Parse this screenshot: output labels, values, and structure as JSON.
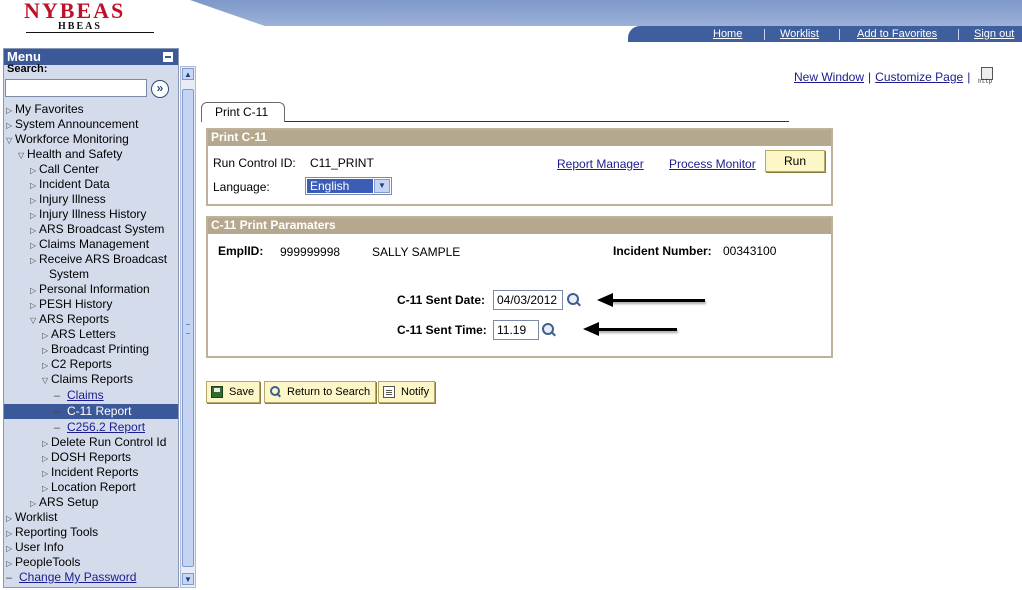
{
  "header": {
    "logo_title": "NYBEAS",
    "logo_subtitle": "HBEAS",
    "nav": [
      "Home",
      "Worklist",
      "Add to Favorites",
      "Sign out"
    ]
  },
  "menu": {
    "title": "Menu",
    "search_label": "Search:",
    "search_value": "",
    "search_go_icon": "go-arrow-icon",
    "items": [
      {
        "label": "My Favorites",
        "icon": "collapsed"
      },
      {
        "label": "System Announcement",
        "icon": "collapsed"
      },
      {
        "label": "Workforce Monitoring",
        "icon": "expanded"
      },
      {
        "label": "Health and Safety",
        "icon": "expanded"
      },
      {
        "label": "Call Center",
        "icon": "collapsed"
      },
      {
        "label": "Incident Data",
        "icon": "collapsed"
      },
      {
        "label": "Injury Illness",
        "icon": "collapsed"
      },
      {
        "label": "Injury Illness History",
        "icon": "collapsed"
      },
      {
        "label": "ARS Broadcast System",
        "icon": "collapsed"
      },
      {
        "label": "Claims Management",
        "icon": "collapsed"
      },
      {
        "label": "Receive ARS Broadcast",
        "icon": "collapsed"
      },
      {
        "label": "System",
        "icon": "none"
      },
      {
        "label": "Personal Information",
        "icon": "collapsed"
      },
      {
        "label": "PESH History",
        "icon": "collapsed"
      },
      {
        "label": "ARS Reports",
        "icon": "expanded"
      },
      {
        "label": "ARS Letters",
        "icon": "collapsed"
      },
      {
        "label": "Broadcast Printing",
        "icon": "collapsed"
      },
      {
        "label": "C2 Reports",
        "icon": "collapsed"
      },
      {
        "label": "Claims Reports",
        "icon": "expanded"
      },
      {
        "label": "Claims",
        "icon": "dash"
      },
      {
        "label": "C-11 Report",
        "icon": "dash",
        "selected": true
      },
      {
        "label": "C256.2 Report",
        "icon": "dash"
      },
      {
        "label": "Delete Run Control Id",
        "icon": "collapsed"
      },
      {
        "label": "DOSH Reports",
        "icon": "collapsed"
      },
      {
        "label": "Incident Reports",
        "icon": "collapsed"
      },
      {
        "label": "Location Report",
        "icon": "collapsed"
      },
      {
        "label": "ARS Setup",
        "icon": "collapsed"
      },
      {
        "label": "Worklist",
        "icon": "collapsed"
      },
      {
        "label": "Reporting Tools",
        "icon": "collapsed"
      },
      {
        "label": "User Info",
        "icon": "collapsed"
      },
      {
        "label": "PeopleTools",
        "icon": "collapsed"
      },
      {
        "label": "Change My Password",
        "icon": "dash"
      }
    ]
  },
  "page_links": {
    "new_window": "New Window",
    "customize_page": "Customize Page",
    "separator": "|",
    "http_icon_text": "http"
  },
  "tab": {
    "label": "Print C-11"
  },
  "run_control": {
    "header": "Print C-11",
    "run_control_label": "Run Control ID:",
    "run_control_value": "C11_PRINT",
    "report_manager": "Report Manager",
    "process_monitor": "Process Monitor",
    "run_button": "Run",
    "language_label": "Language:",
    "language_value": "English"
  },
  "params": {
    "header": "C-11 Print Paramaters",
    "emplid_label": "EmplID:",
    "emplid_value": "999999998",
    "employee_name": "SALLY SAMPLE",
    "incident_label": "Incident Number:",
    "incident_value": "00343100",
    "sent_date_label": "C-11 Sent Date:",
    "sent_date_value": "04/03/2012",
    "sent_time_label": "C-11 Sent Time:",
    "sent_time_value": "11.19"
  },
  "buttons": {
    "save": "Save",
    "return_to_search": "Return to Search",
    "notify": "Notify"
  },
  "colors": {
    "menu_header": "#3b5998",
    "group_header": "#b5a88e",
    "button_bg": "#fdf7c7",
    "link": "#1c1c8f"
  }
}
